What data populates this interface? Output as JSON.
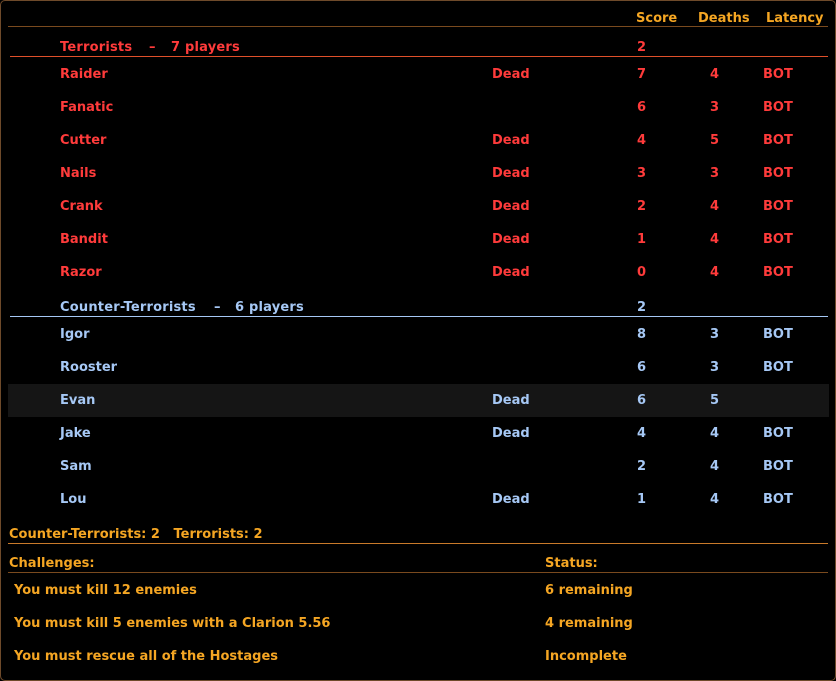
{
  "columns": {
    "score": "Score",
    "deaths": "Deaths",
    "latency": "Latency"
  },
  "terrorists": {
    "name": "Terrorists",
    "separator": "–",
    "count_label": "7 players",
    "score": "2",
    "players": [
      {
        "name": "Raider",
        "status": "Dead",
        "score": "7",
        "deaths": "4",
        "latency": "BOT"
      },
      {
        "name": "Fanatic",
        "status": "",
        "score": "6",
        "deaths": "3",
        "latency": "BOT"
      },
      {
        "name": "Cutter",
        "status": "Dead",
        "score": "4",
        "deaths": "5",
        "latency": "BOT"
      },
      {
        "name": "Nails",
        "status": "Dead",
        "score": "3",
        "deaths": "3",
        "latency": "BOT"
      },
      {
        "name": "Crank",
        "status": "Dead",
        "score": "2",
        "deaths": "4",
        "latency": "BOT"
      },
      {
        "name": "Bandit",
        "status": "Dead",
        "score": "1",
        "deaths": "4",
        "latency": "BOT"
      },
      {
        "name": "Razor",
        "status": "Dead",
        "score": "0",
        "deaths": "4",
        "latency": "BOT"
      }
    ]
  },
  "counter_terrorists": {
    "name": "Counter-Terrorists",
    "separator": "–",
    "count_label": "6 players",
    "score": "2",
    "players": [
      {
        "name": "Igor",
        "status": "",
        "score": "8",
        "deaths": "3",
        "latency": "BOT"
      },
      {
        "name": "Rooster",
        "status": "",
        "score": "6",
        "deaths": "3",
        "latency": "BOT"
      },
      {
        "name": "Evan",
        "status": "Dead",
        "score": "6",
        "deaths": "5",
        "latency": ""
      },
      {
        "name": "Jake",
        "status": "Dead",
        "score": "4",
        "deaths": "4",
        "latency": "BOT"
      },
      {
        "name": "Sam",
        "status": "",
        "score": "2",
        "deaths": "4",
        "latency": "BOT"
      },
      {
        "name": "Lou",
        "status": "Dead",
        "score": "1",
        "deaths": "4",
        "latency": "BOT"
      }
    ]
  },
  "team_summary": "Counter-Terrorists: 2   Terrorists: 2",
  "challenges": {
    "header": "Challenges:",
    "status_header": "Status:",
    "items": [
      {
        "text": "You must kill 12 enemies",
        "status": "6 remaining"
      },
      {
        "text": "You must kill 5 enemies with a Clarion 5.56",
        "status": "4 remaining"
      },
      {
        "text": "You must rescue all of the Hostages",
        "status": "Incomplete"
      }
    ]
  },
  "colors": {
    "terrorist": "#ff3b3b",
    "counter_terrorist": "#a6c8f5",
    "accent": "#f5a623"
  }
}
